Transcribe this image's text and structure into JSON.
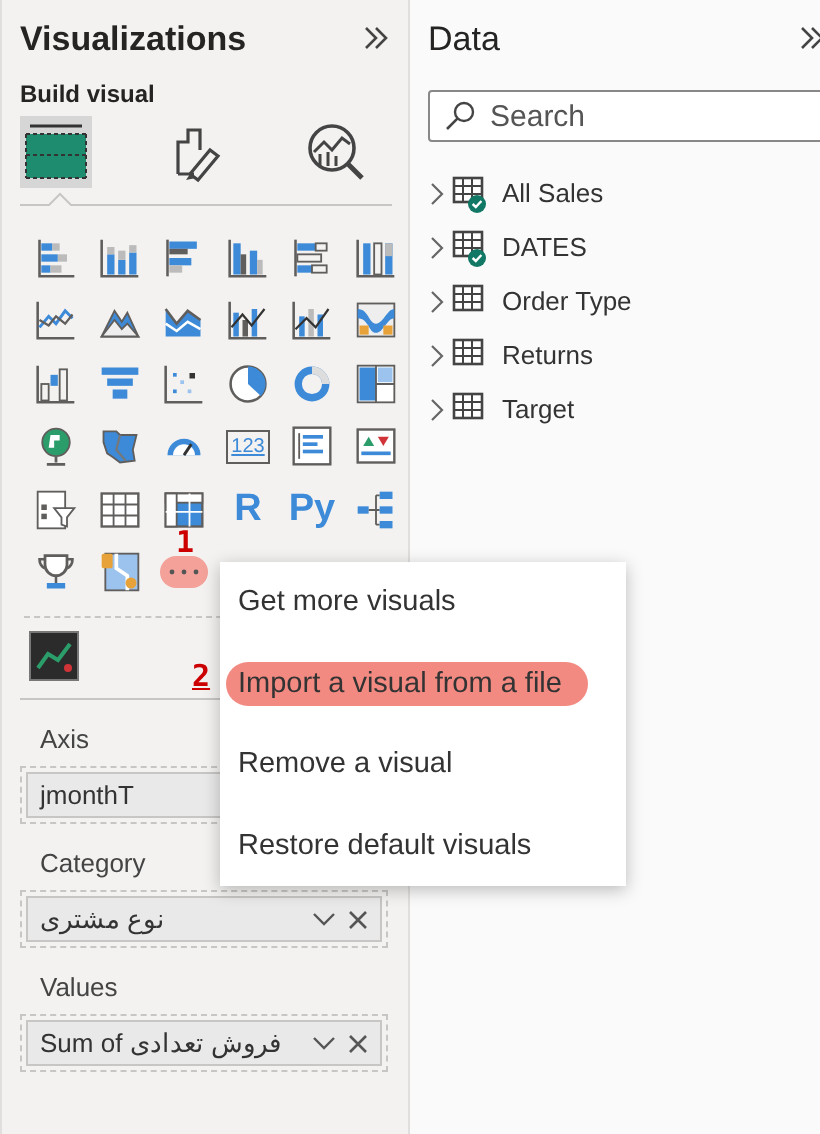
{
  "visualizations": {
    "title": "Visualizations",
    "subtitle": "Build visual",
    "tabs": [
      {
        "kind": "build",
        "selected": true
      },
      {
        "kind": "format",
        "selected": false
      },
      {
        "kind": "analytics",
        "selected": false
      }
    ],
    "visuals": [
      {
        "kind": "hbar-stacked"
      },
      {
        "kind": "vbar-stacked"
      },
      {
        "kind": "hbar-clustered"
      },
      {
        "kind": "vbar-clustered"
      },
      {
        "kind": "hbar-full"
      },
      {
        "kind": "vbar-full"
      },
      {
        "kind": "line"
      },
      {
        "kind": "area"
      },
      {
        "kind": "stacked-area"
      },
      {
        "kind": "line-column"
      },
      {
        "kind": "line-column-stacked"
      },
      {
        "kind": "ribbon"
      },
      {
        "kind": "waterfall"
      },
      {
        "kind": "funnel"
      },
      {
        "kind": "scatter"
      },
      {
        "kind": "pie"
      },
      {
        "kind": "donut"
      },
      {
        "kind": "treemap"
      },
      {
        "kind": "globe"
      },
      {
        "kind": "filled-map"
      },
      {
        "kind": "gauge"
      },
      {
        "kind": "card",
        "label": "123"
      },
      {
        "kind": "multirow-card"
      },
      {
        "kind": "kpi"
      },
      {
        "kind": "slicer"
      },
      {
        "kind": "table"
      },
      {
        "kind": "matrix"
      },
      {
        "kind": "text",
        "label": "R"
      },
      {
        "kind": "text",
        "label": "Py"
      },
      {
        "kind": "decomposition"
      },
      {
        "kind": "trophy"
      },
      {
        "kind": "azure-map"
      },
      {
        "kind": "more",
        "highlighted": true,
        "annotation": "1"
      }
    ],
    "custom_visuals": [
      {
        "kind": "custom-line"
      }
    ],
    "wells": [
      {
        "label": "Axis",
        "fields": [
          {
            "value": "jmonthT"
          }
        ]
      },
      {
        "label": "Category",
        "fields": [
          {
            "value": "نوع مشتری",
            "show_controls": true
          }
        ]
      },
      {
        "label": "Values",
        "fields": [
          {
            "value": "Sum of فروش تعدادی",
            "show_controls": true
          }
        ]
      }
    ]
  },
  "menu": {
    "items": [
      {
        "label": "Get more visuals",
        "selected": false
      },
      {
        "label": "Import a visual from a file",
        "selected": true,
        "annotation": "2"
      },
      {
        "label": "Remove a visual",
        "selected": false
      },
      {
        "label": "Restore default visuals",
        "selected": false
      }
    ]
  },
  "data": {
    "title": "Data",
    "search": {
      "placeholder": "Search"
    },
    "tables": [
      {
        "name": "All Sales",
        "in_use": true
      },
      {
        "name": "DATES",
        "in_use": true
      },
      {
        "name": "Order Type",
        "in_use": false
      },
      {
        "name": "Returns",
        "in_use": false
      },
      {
        "name": "Target",
        "in_use": false
      }
    ]
  }
}
